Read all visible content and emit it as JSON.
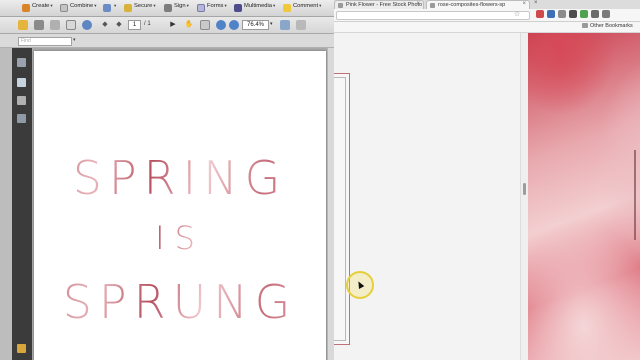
{
  "browser": {
    "tabs": [
      {
        "label": "Pink Flower - Free Stock Photo"
      },
      {
        "label": "rose-composites-flowers-sp"
      }
    ],
    "other_bookmarks_label": "Other Bookmarks"
  },
  "acrobat": {
    "menu": {
      "create": "Create",
      "combine": "Combine",
      "secure": "Secure",
      "sign": "Sign",
      "forms": "Forms",
      "multimedia": "Multimedia",
      "comment": "Comment"
    },
    "toolbar": {
      "page_current": "1",
      "page_total": "/ 1",
      "zoom": "76.4%"
    },
    "find_placeholder": "Find"
  },
  "document": {
    "line1": "SPRING",
    "line2": "IS",
    "line3": "SPRUNG"
  },
  "colors": {
    "text_gradient_dark": "#b6505f",
    "text_gradient_light": "#f1cdd1",
    "cursor_highlight": "#e6cf3c",
    "photo_pink": "#e8a9ae"
  },
  "icons": {
    "menu": [
      "create-icon",
      "combine-icon",
      "secure-icon",
      "sign-icon",
      "forms-icon",
      "multimedia-icon",
      "comment-icon"
    ],
    "nav": [
      "pages-icon",
      "bookmarks-icon",
      "layers-icon",
      "signatures-icon",
      "attachments-icon"
    ]
  }
}
